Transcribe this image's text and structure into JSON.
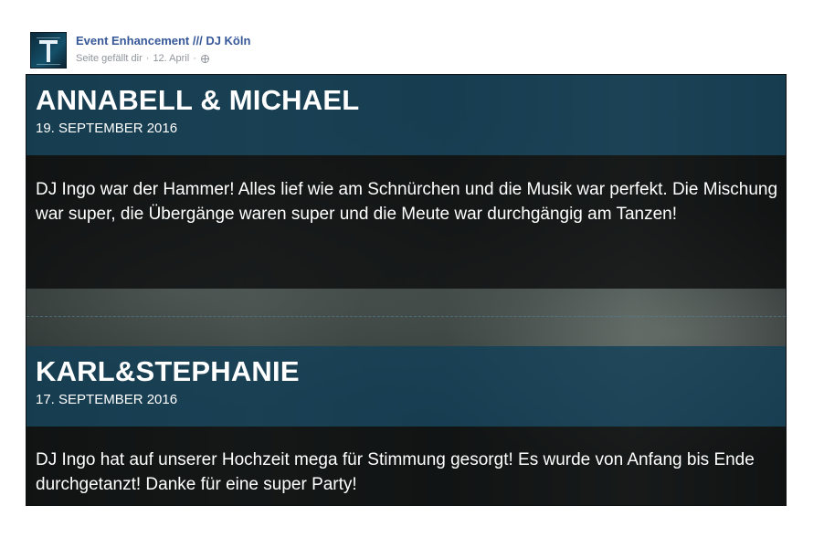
{
  "post": {
    "page_name": "Event Enhancement /// DJ Köln",
    "liked_status": "Seite gefällt dir",
    "separator": "·",
    "date": "12. April",
    "separator2": "·",
    "audience_icon": "globe-icon"
  },
  "reviews": [
    {
      "name": "ANNABELL & MICHAEL",
      "date": "19. SEPTEMBER 2016",
      "text": "DJ Ingo war der Hammer! Alles lief wie am Schnürchen und die Musik war perfekt. Die Mischung war super, die Übergänge waren super und die Meute war durchgängig am Tanzen!"
    },
    {
      "name": "KARL&STEPHANIE",
      "date": "17. SEPTEMBER 2016",
      "text": "DJ Ingo hat auf unserer Hochzeit mega für Stimmung gesorgt! Es wurde von Anfang bis Ende durchgetanzt! Danke für eine super Party!"
    }
  ],
  "colors": {
    "link": "#365899",
    "meta": "#90949c",
    "title_band": "#123f58",
    "body_band": "#0a0c0c"
  }
}
